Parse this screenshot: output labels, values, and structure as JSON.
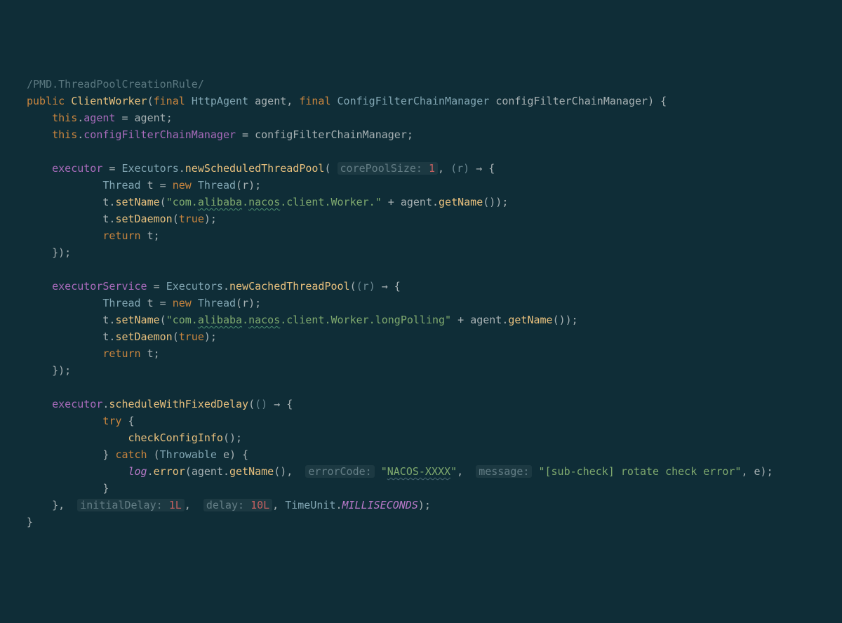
{
  "comment": "/PMD.ThreadPoolCreationRule/",
  "kw": {
    "public": "public",
    "final": "final",
    "new": "new",
    "return": "return",
    "try": "try",
    "catch": "catch",
    "true1": "true",
    "true2": "true",
    "this1": "this",
    "this2": "this"
  },
  "ctor": "ClientWorker",
  "type": {
    "httpagent": "HttpAgent",
    "cfcm": "ConfigFilterChainManager",
    "thread1": "Thread",
    "thread1b": "Thread",
    "thread2": "Thread",
    "thread2b": "Thread",
    "throwable": "Throwable",
    "timeunit": "TimeUnit",
    "executors1": "Executors",
    "executors2": "Executors"
  },
  "ident": {
    "agent_param": "agent",
    "cfcm_param": "configFilterChainManager",
    "agent_rhs": "agent",
    "cfcm_rhs": "configFilterChainManager",
    "r1": "r",
    "r1b": "r",
    "t1a": "t",
    "t1b": "t",
    "t1c": "t",
    "t1d": "t",
    "t1e": "t",
    "r2": "r",
    "r2b": "r",
    "t2a": "t",
    "t2b": "t",
    "t2c": "t",
    "t2d": "t",
    "t2e": "t",
    "e": "e",
    "e2": "e",
    "agent1": "agent",
    "agent2": "agent",
    "agent3": "agent"
  },
  "field": {
    "agent": "agent",
    "cfcm": "configFilterChainManager",
    "executor1": "executor",
    "executorService": "executorService",
    "executor2": "executor"
  },
  "method": {
    "newScheduledThreadPool": "newScheduledThreadPool",
    "newCachedThreadPool": "newCachedThreadPool",
    "setName1": "setName",
    "setName2": "setName",
    "setDaemon1": "setDaemon",
    "setDaemon2": "setDaemon",
    "getName1": "getName",
    "getName2": "getName",
    "getName3": "getName",
    "scheduleWithFixedDelay": "scheduleWithFixedDelay",
    "checkConfigInfo": "checkConfigInfo",
    "error": "error"
  },
  "string": {
    "worker": "\"com.",
    "worker_al": "alibaba",
    "worker_dot1": ".",
    "worker_nacos": "nacos",
    "worker_rest": ".client.Worker.\"",
    "lp": "\"com.",
    "lp_al": "alibaba",
    "lp_dot1": ".",
    "lp_nacos": "nacos",
    "lp_rest": ".client.Worker.longPolling\"",
    "nacos_err_open": "\"",
    "nacos_err": "NACOS-XXXX",
    "nacos_err_close": "\"",
    "subcheck": "\"[sub-check] rotate check error\""
  },
  "hint": {
    "corePoolSize": "corePoolSize:",
    "corePoolSize_val": "1",
    "errorCode": "errorCode:",
    "message": "message:",
    "initialDelay": "initialDelay:",
    "initialDelay_val": "1L",
    "delay": "delay:",
    "delay_val": "10L"
  },
  "static": {
    "log": "log",
    "ms": "MILLISECONDS"
  },
  "arrow": "→"
}
